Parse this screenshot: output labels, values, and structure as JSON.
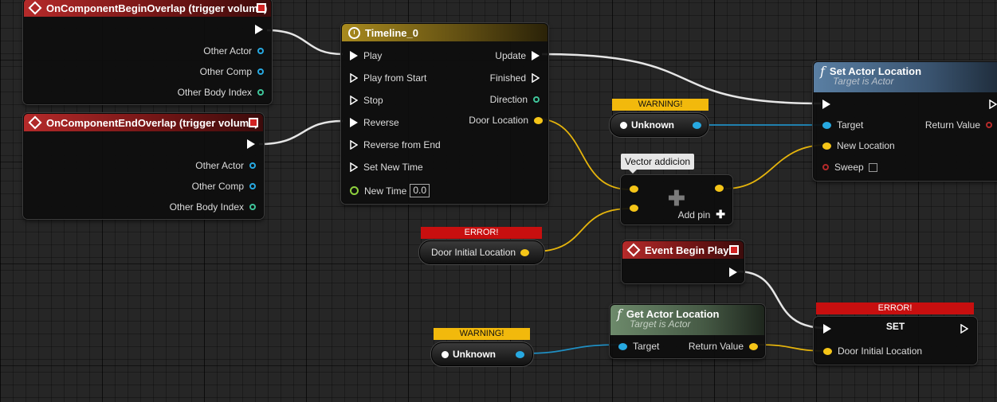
{
  "nodes": {
    "begin_overlap": {
      "title": "OnComponentBeginOverlap (trigger volume)",
      "pins": [
        "Other Actor",
        "Other Comp",
        "Other Body Index"
      ]
    },
    "end_overlap": {
      "title": "OnComponentEndOverlap (trigger volume)",
      "pins": [
        "Other Actor",
        "Other Comp",
        "Other Body Index"
      ]
    },
    "timeline": {
      "title": "Timeline_0",
      "inputs": [
        "Play",
        "Play from Start",
        "Stop",
        "Reverse",
        "Reverse from End",
        "Set New Time",
        "New Time"
      ],
      "new_time_value": "0.0",
      "outputs": [
        "Update",
        "Finished",
        "Direction",
        "Door Location"
      ]
    },
    "set_actor_location": {
      "title": "Set Actor Location",
      "subtitle": "Target is Actor",
      "pins": [
        "Target",
        "New Location",
        "Sweep"
      ],
      "return": "Return Value"
    },
    "vector_add": {
      "tooltip": "Vector addicion",
      "add_pin": "Add pin"
    },
    "unknown_1": {
      "banner": "WARNING!",
      "label": "Unknown"
    },
    "door_initial_location_var": {
      "banner": "ERROR!",
      "label": "Door Initial Location"
    },
    "event_begin_play": {
      "title": "Event Begin Play"
    },
    "get_actor_location": {
      "title": "Get Actor Location",
      "subtitle": "Target is Actor",
      "target": "Target",
      "return": "Return Value"
    },
    "unknown_2": {
      "banner": "WARNING!",
      "label": "Unknown"
    },
    "set_node": {
      "banner": "ERROR!",
      "title": "SET",
      "pin": "Door Initial Location"
    }
  },
  "colors": {
    "exec": "#ffffff",
    "object": "#27a9e1",
    "vector": "#f5c518",
    "int": "#3fc59a",
    "event_header": "#b52a2a",
    "warning": "#f2b90c",
    "error": "#c80f0f"
  }
}
